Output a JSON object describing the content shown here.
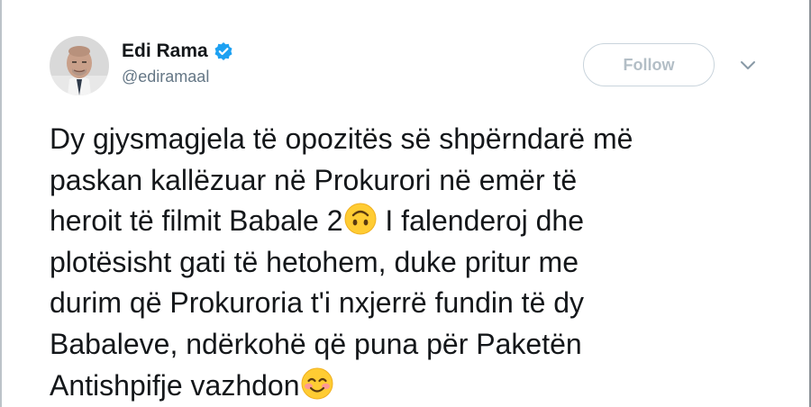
{
  "tweet": {
    "author": {
      "name": "Edi Rama",
      "handle": "@ediramaal",
      "verified_icon": "verified-badge-icon",
      "avatar": "avatar"
    },
    "follow_label": "Follow",
    "menu_icon": "chevron-down-icon",
    "text_lines": [
      "Dy gjysmagjela të opozitës së shpërndarë më",
      "paskan kallëzuar në Prokurori në emër të",
      "heroit të filmit Babale 2",
      " I falenderoj dhe",
      "plotësisht gati të hetohem, duke pritur me",
      "durim që Prokuroria t'i nxjerrë fundin të dy",
      "Babaleve, ndërkohë që puna për Paketën",
      "Antishpifje vazhdon"
    ],
    "emojis": [
      "upside-down-face-emoji-icon",
      "smiling-blushing-face-emoji-icon"
    ],
    "colors": {
      "text": "#14171a",
      "secondary": "#657786",
      "verified": "#1da1f2",
      "follow_border": "#c9d4dc",
      "follow_text": "#b3bec6",
      "emoji_yellow": "#ffcc33"
    }
  }
}
